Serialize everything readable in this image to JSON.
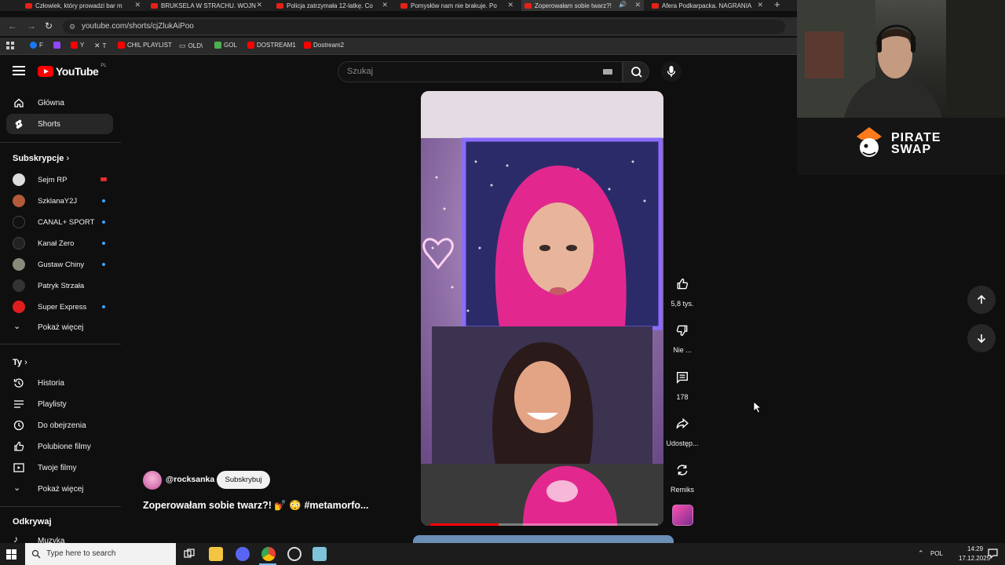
{
  "browser": {
    "tabs": [
      {
        "label": "Człowiek, który prowadzi bar m",
        "active": false
      },
      {
        "label": "BRUKSELA W STRACHU. WOJN",
        "active": false
      },
      {
        "label": "Policja zatrzymała 12-latkę. Co",
        "active": false
      },
      {
        "label": "Pomysłów nam nie brakuje. Po",
        "active": false
      },
      {
        "label": "Zoperowałam sobie twarz?!",
        "active": true
      },
      {
        "label": "Afera Podkarpacka. NAGRANIA",
        "active": false
      }
    ],
    "url": "youtube.com/shorts/cjZlukAiPoo",
    "bookmarks": [
      {
        "label": "F",
        "icon": "facebook-icon",
        "color": "#1877f2"
      },
      {
        "label": "",
        "icon": "twitch-icon",
        "color": "#9146ff"
      },
      {
        "label": "Y",
        "icon": "youtube-icon",
        "color": "#ff0000"
      },
      {
        "label": "T",
        "icon": "x-icon",
        "color": "#ffffff"
      },
      {
        "label": "CHIL PLAYLIST",
        "icon": "youtube-icon",
        "color": "#ff0000"
      },
      {
        "label": "OLD\\",
        "icon": "folder-icon",
        "color": "#cccccc"
      },
      {
        "label": "GOL",
        "icon": "gol-icon",
        "color": "#4caf50"
      },
      {
        "label": "DOSTREAM1",
        "icon": "youtube-icon",
        "color": "#ff0000"
      },
      {
        "label": "Dostream2",
        "icon": "youtube-icon",
        "color": "#ff0000"
      }
    ]
  },
  "header": {
    "logo_text": "YouTube",
    "region": "PL",
    "search_placeholder": "Szukaj"
  },
  "sidebar": {
    "main": [
      {
        "label": "Główna",
        "icon": "home-icon",
        "active": false
      },
      {
        "label": "Shorts",
        "icon": "shorts-icon",
        "active": true
      }
    ],
    "subscriptions_heading": "Subskrypcje",
    "subscriptions": [
      {
        "label": "Sejm RP",
        "color": "#dddddd",
        "badge": "live"
      },
      {
        "label": "SzklanaY2J",
        "color": "#b35a3a",
        "badge": "dot"
      },
      {
        "label": "CANAL+ SPORT",
        "color": "#111111",
        "badge": "dot"
      },
      {
        "label": "Kanał Zero",
        "color": "#222222",
        "badge": "dot"
      },
      {
        "label": "Gustaw Chiny",
        "color": "#8a8a7a",
        "badge": "dot"
      },
      {
        "label": "Patryk Strzała",
        "color": "#333333",
        "badge": ""
      },
      {
        "label": "Super Express",
        "color": "#e01e1e",
        "badge": "dot"
      }
    ],
    "show_more": "Pokaż więcej",
    "you_heading": "Ty",
    "you_items": [
      {
        "label": "Historia",
        "icon": "history-icon"
      },
      {
        "label": "Playlisty",
        "icon": "playlist-icon"
      },
      {
        "label": "Do obejrzenia",
        "icon": "clock-icon"
      },
      {
        "label": "Polubione filmy",
        "icon": "thumb-up-icon"
      },
      {
        "label": "Twoje filmy",
        "icon": "video-icon"
      }
    ],
    "show_more_2": "Pokaż więcej",
    "explore_heading": "Odkrywaj",
    "explore_items": [
      {
        "label": "Muzyka",
        "icon": "music-icon"
      }
    ]
  },
  "short": {
    "channel": "@rocksanka",
    "subscribe_label": "Subskrybuj",
    "title": "Zoperowałam sobie twarz?! 💅 😳 #metamorfo...",
    "progress": 0.3,
    "actions": {
      "likes": "5,8 tys.",
      "dislike": "Nie ...",
      "comments": "178",
      "share": "Udostęp...",
      "remix": "Remiks"
    }
  },
  "overlay": {
    "sponsor_text_1": "PIRATE",
    "sponsor_text_2": "SWAP"
  },
  "taskbar": {
    "search_placeholder": "Type here to search",
    "language": "POL",
    "time": "14:29",
    "date": "17.12.2025"
  }
}
